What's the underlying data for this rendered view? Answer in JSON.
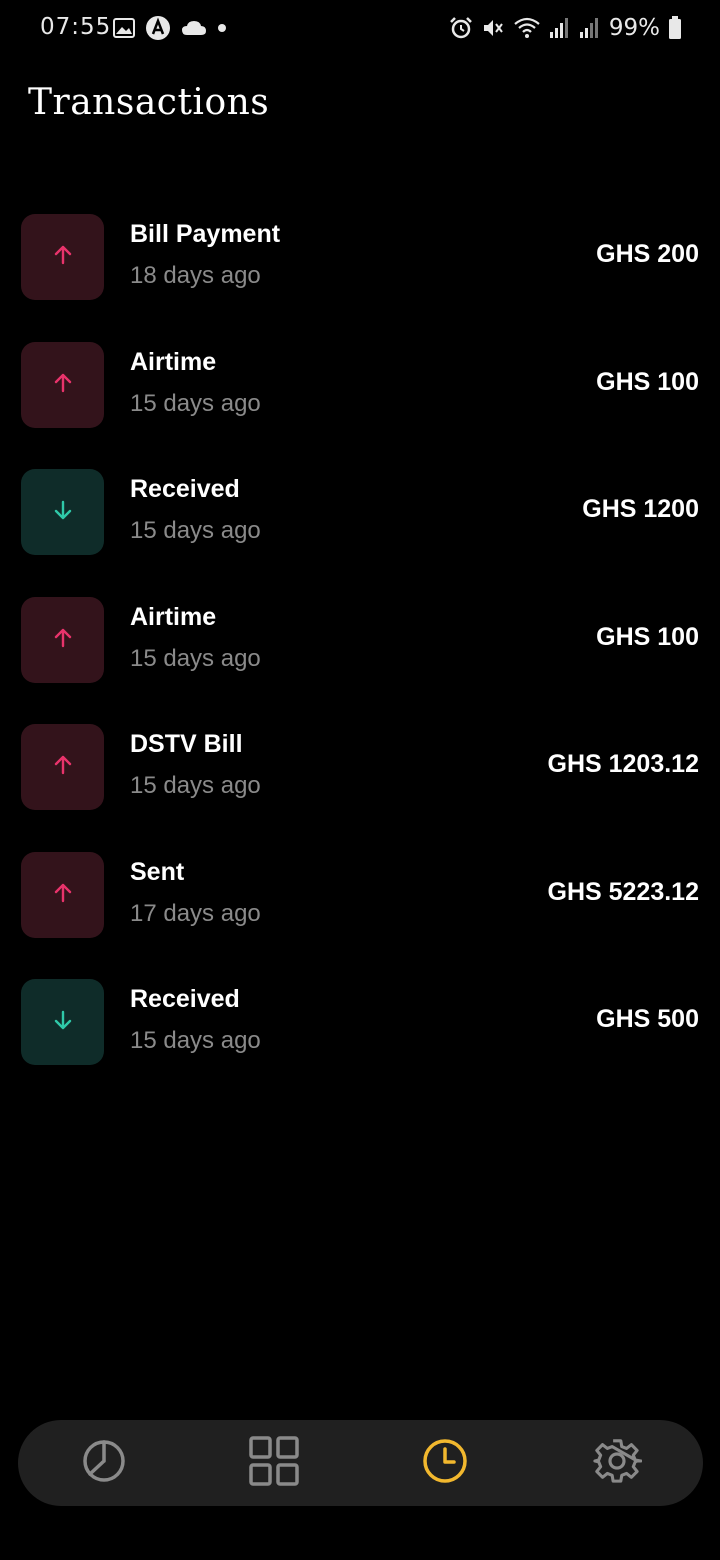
{
  "status_bar": {
    "time": "07:55",
    "battery": "99%",
    "left_icons": [
      "image-icon",
      "a-badge-icon",
      "cloud-icon",
      "dot-icon"
    ],
    "right_icons": [
      "alarm-icon",
      "mute-icon",
      "wifi-icon",
      "signal-icon",
      "signal-icon",
      "battery-icon"
    ]
  },
  "page": {
    "title": "Transactions"
  },
  "transactions": [
    {
      "title": "Bill Payment",
      "date": "18 days ago",
      "amount": "GHS 200",
      "direction": "out"
    },
    {
      "title": "Airtime",
      "date": "15 days ago",
      "amount": "GHS 100",
      "direction": "out"
    },
    {
      "title": "Received",
      "date": "15 days ago",
      "amount": "GHS 1200",
      "direction": "in"
    },
    {
      "title": "Airtime",
      "date": "15 days ago",
      "amount": "GHS 100",
      "direction": "out"
    },
    {
      "title": "DSTV Bill",
      "date": "15 days ago",
      "amount": "GHS 1203.12",
      "direction": "out"
    },
    {
      "title": "Sent",
      "date": "17 days ago",
      "amount": "GHS 5223.12",
      "direction": "out"
    },
    {
      "title": "Received",
      "date": "15 days ago",
      "amount": "GHS 500",
      "direction": "in"
    }
  ],
  "bottom_nav": {
    "items": [
      {
        "icon": "pie-chart-icon",
        "active": false
      },
      {
        "icon": "grid-icon",
        "active": false
      },
      {
        "icon": "clock-icon",
        "active": true
      },
      {
        "icon": "gear-icon",
        "active": false
      }
    ]
  },
  "colors": {
    "background": "#000000",
    "outgoing_box": "#33131b",
    "outgoing_arrow": "#e8336b",
    "incoming_box": "#0f2c29",
    "incoming_arrow": "#2fc8a8",
    "nav_background": "#202020",
    "nav_active": "#f2b82e",
    "nav_inactive": "#8a8a8a",
    "muted_text": "#8a8a8a"
  }
}
